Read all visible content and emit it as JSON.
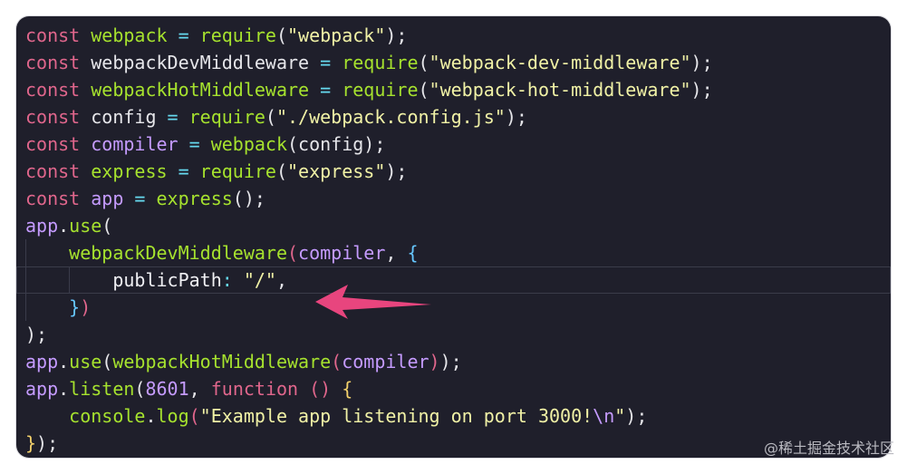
{
  "code": {
    "lines": [
      [
        {
          "t": "const ",
          "c": "kw"
        },
        {
          "t": "webpack",
          "c": "var"
        },
        {
          "t": " = ",
          "c": "op"
        },
        {
          "t": "require",
          "c": "fn"
        },
        {
          "t": "(",
          "c": "plain"
        },
        {
          "t": "\"webpack\"",
          "c": "str"
        },
        {
          "t": ");",
          "c": "plain"
        }
      ],
      [
        {
          "t": "const ",
          "c": "kw"
        },
        {
          "t": "webpackDevMiddleware",
          "c": "plain"
        },
        {
          "t": " = ",
          "c": "op"
        },
        {
          "t": "require",
          "c": "fn"
        },
        {
          "t": "(",
          "c": "plain"
        },
        {
          "t": "\"webpack-dev-middleware\"",
          "c": "str"
        },
        {
          "t": ");",
          "c": "plain"
        }
      ],
      [
        {
          "t": "const ",
          "c": "kw"
        },
        {
          "t": "webpackHotMiddleware",
          "c": "var"
        },
        {
          "t": " = ",
          "c": "op"
        },
        {
          "t": "require",
          "c": "fn"
        },
        {
          "t": "(",
          "c": "plain"
        },
        {
          "t": "\"webpack-hot-middleware\"",
          "c": "str"
        },
        {
          "t": ");",
          "c": "plain"
        }
      ],
      [
        {
          "t": "const ",
          "c": "kw"
        },
        {
          "t": "config",
          "c": "plain"
        },
        {
          "t": " = ",
          "c": "op"
        },
        {
          "t": "require",
          "c": "fn"
        },
        {
          "t": "(",
          "c": "plain"
        },
        {
          "t": "\"./webpack.config.js\"",
          "c": "str"
        },
        {
          "t": ");",
          "c": "plain"
        }
      ],
      [
        {
          "t": "const ",
          "c": "kw"
        },
        {
          "t": "compiler",
          "c": "param"
        },
        {
          "t": " = ",
          "c": "op"
        },
        {
          "t": "webpack",
          "c": "fn"
        },
        {
          "t": "(config);",
          "c": "plain"
        }
      ],
      [
        {
          "t": "const ",
          "c": "kw"
        },
        {
          "t": "express",
          "c": "var"
        },
        {
          "t": " = ",
          "c": "op"
        },
        {
          "t": "require",
          "c": "fn"
        },
        {
          "t": "(",
          "c": "plain"
        },
        {
          "t": "\"express\"",
          "c": "str"
        },
        {
          "t": ");",
          "c": "plain"
        }
      ],
      [
        {
          "t": "const ",
          "c": "kw"
        },
        {
          "t": "app",
          "c": "param"
        },
        {
          "t": " = ",
          "c": "op"
        },
        {
          "t": "express",
          "c": "fn"
        },
        {
          "t": "();",
          "c": "plain"
        }
      ],
      [
        {
          "t": "app",
          "c": "param"
        },
        {
          "t": ".",
          "c": "plain"
        },
        {
          "t": "use",
          "c": "fn"
        },
        {
          "t": "(",
          "c": "plain"
        }
      ],
      [
        {
          "t": "    ",
          "c": "plain"
        },
        {
          "t": "webpackDevMiddleware",
          "c": "fn"
        },
        {
          "t": "(",
          "c": "brace-c"
        },
        {
          "t": "compiler",
          "c": "param"
        },
        {
          "t": ", ",
          "c": "plain"
        },
        {
          "t": "{",
          "c": "brace-b"
        }
      ],
      [
        {
          "t": "        publicPath",
          "c": "prop"
        },
        {
          "t": ": ",
          "c": "op"
        },
        {
          "t": "\"/\"",
          "c": "str"
        },
        {
          "t": ",",
          "c": "plain"
        }
      ],
      [
        {
          "t": "    ",
          "c": "plain"
        },
        {
          "t": "}",
          "c": "brace-b"
        },
        {
          "t": ")",
          "c": "brace-c"
        }
      ],
      [
        {
          "t": ");",
          "c": "plain"
        }
      ],
      [
        {
          "t": "app",
          "c": "param"
        },
        {
          "t": ".",
          "c": "plain"
        },
        {
          "t": "use",
          "c": "fn"
        },
        {
          "t": "(",
          "c": "plain"
        },
        {
          "t": "webpackHotMiddleware",
          "c": "fn"
        },
        {
          "t": "(",
          "c": "brace-c"
        },
        {
          "t": "compiler",
          "c": "param"
        },
        {
          "t": ")",
          "c": "brace-c"
        },
        {
          "t": ");",
          "c": "plain"
        }
      ],
      [
        {
          "t": "app",
          "c": "param"
        },
        {
          "t": ".",
          "c": "plain"
        },
        {
          "t": "listen",
          "c": "fn"
        },
        {
          "t": "(",
          "c": "plain"
        },
        {
          "t": "8601",
          "c": "num"
        },
        {
          "t": ", ",
          "c": "plain"
        },
        {
          "t": "function",
          "c": "kw"
        },
        {
          "t": " () ",
          "c": "kw"
        },
        {
          "t": "{",
          "c": "brace-a"
        }
      ],
      [
        {
          "t": "    console",
          "c": "fn"
        },
        {
          "t": ".",
          "c": "plain"
        },
        {
          "t": "log",
          "c": "fn"
        },
        {
          "t": "(",
          "c": "brace-c"
        },
        {
          "t": "\"Example app listening on port 3000!",
          "c": "str"
        },
        {
          "t": "\\n",
          "c": "esc"
        },
        {
          "t": "\"",
          "c": "str"
        },
        {
          "t": ");",
          "c": "plain"
        }
      ],
      [
        {
          "t": "}",
          "c": "brace-a"
        },
        {
          "t": ");",
          "c": "plain"
        }
      ]
    ]
  },
  "colors": {
    "background": "#1f1f2b",
    "arrow": "#e8457e"
  },
  "watermark": "@稀土掘金技术社区"
}
